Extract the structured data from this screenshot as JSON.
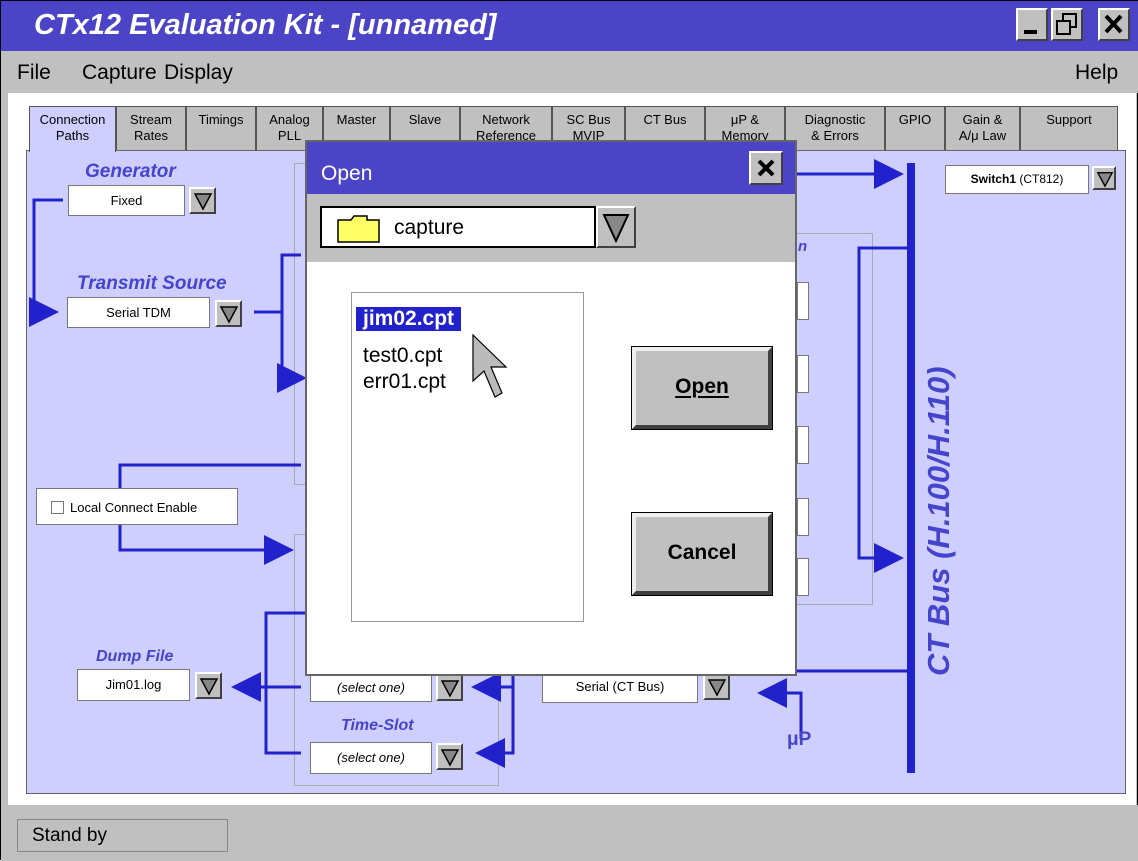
{
  "window": {
    "title": "CTx12 Evaluation Kit - [unnamed]"
  },
  "menu": [
    "File",
    "Capture",
    "Display",
    "Help"
  ],
  "tabs": [
    "Connection\nPaths",
    "Stream\nRates",
    "Timings",
    "Analog\nPLL",
    "Master",
    "Slave",
    "Network\nReference",
    "SC Bus\nMVIP",
    "CT Bus",
    "μP &\nMemory",
    "Diagnostic\n& Errors",
    "GPIO",
    "Gain &\nA/μ Law",
    "Support"
  ],
  "panel": {
    "generator_label": "Generator",
    "generator_value": "Fixed",
    "transmit_label": "Transmit Source",
    "transmit_value": "Serial TDM",
    "local_connect": "Local Connect Enable",
    "dump_label": "Dump File",
    "dump_value": "Jim01.log",
    "select1": "(select one)",
    "timeslot_label": "Time-Slot",
    "select2": "(select one)",
    "serial_ctbus": "Serial (CT Bus)",
    "up_label": "μP",
    "switch_bold": "Switch1",
    "switch_rest": "(CT812)",
    "ctbus_label": "CT Bus (H.100/H.110)",
    "partial_n": "n"
  },
  "dialog": {
    "title": "Open",
    "folder": "capture",
    "files": [
      "jim02.cpt",
      "test0.cpt",
      "err01.cpt"
    ],
    "selected_file": "jim02.cpt",
    "open_button": "Open",
    "cancel_button": "Cancel"
  },
  "status": "Stand by",
  "colors": {
    "titlebar": "#4b44c6",
    "panel": "#cfcfff",
    "accent": "#2222cc"
  }
}
